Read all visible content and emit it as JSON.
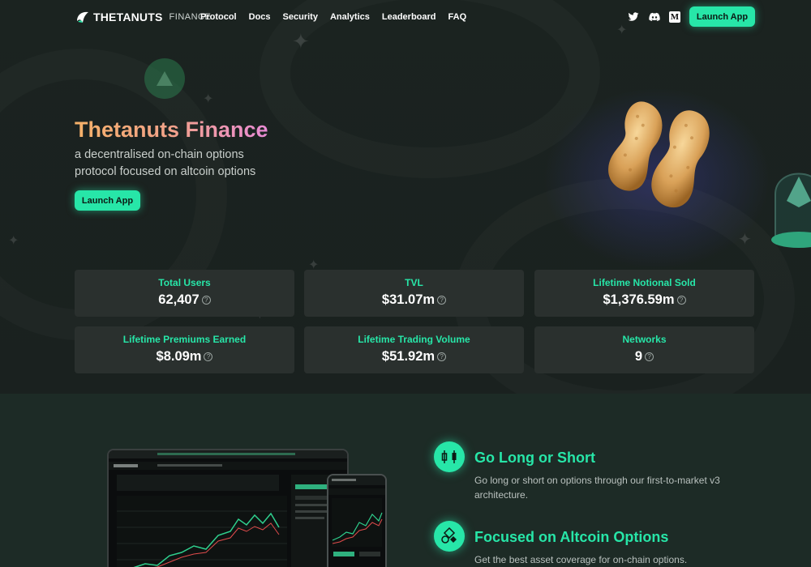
{
  "nav": {
    "brand": "THETANUTS",
    "brand_sub": "FINANCE",
    "links": [
      "Protocol",
      "Docs",
      "Security",
      "Analytics",
      "Leaderboard",
      "FAQ"
    ],
    "launch_label": "Launch App",
    "social": [
      "twitter-icon",
      "discord-icon",
      "medium-icon"
    ]
  },
  "hero": {
    "title": "Thetanuts Finance",
    "subtitle": "a decentralised on-chain options protocol focused on altcoin options",
    "launch_label": "Launch App"
  },
  "stats": [
    {
      "label": "Total Users",
      "value": "62,407"
    },
    {
      "label": "TVL",
      "value": "$31.07m"
    },
    {
      "label": "Lifetime Notional Sold",
      "value": "$1,376.59m"
    },
    {
      "label": "Lifetime Premiums Earned",
      "value": "$8.09m"
    },
    {
      "label": "Lifetime Trading Volume",
      "value": "$51.92m"
    },
    {
      "label": "Networks",
      "value": "9"
    }
  ],
  "features": [
    {
      "title": "Go Long or Short",
      "desc": "Go long or short on options through our first-to-market v3 architecture.",
      "icon": "candlestick-icon"
    },
    {
      "title": "Focused on Altcoin Options",
      "desc": "Get the best asset coverage for on-chain options.",
      "icon": "coins-icon"
    }
  ],
  "colors": {
    "accent": "#27e6a8",
    "background": "#1c2421",
    "card": "#2a302e"
  }
}
